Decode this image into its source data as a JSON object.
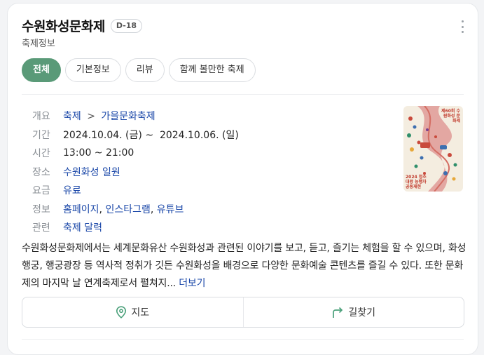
{
  "header": {
    "title": "수원화성문화제",
    "dday_badge": "D-18",
    "subtitle": "축제정보"
  },
  "tabs": [
    {
      "label": "전체",
      "active": true
    },
    {
      "label": "기본정보",
      "active": false
    },
    {
      "label": "리뷰",
      "active": false
    },
    {
      "label": "함께 볼만한 축제",
      "active": false
    }
  ],
  "info": {
    "overview": {
      "label": "개요",
      "category": "축제",
      "separator": ">",
      "subcategory": "가을문화축제"
    },
    "period": {
      "label": "기간",
      "value": "2024.10.04. (금) ~  2024.10.06. (일)"
    },
    "time": {
      "label": "시간",
      "value": "13:00 ~ 21:00"
    },
    "place": {
      "label": "장소",
      "value": "수원화성 일원"
    },
    "fee": {
      "label": "요금",
      "value": "유료"
    },
    "links": {
      "label": "정보",
      "items": [
        "홈페이지",
        "인스타그램",
        "유튜브"
      ],
      "separator": ", "
    },
    "related": {
      "label": "관련",
      "value": "축제 달력"
    }
  },
  "poster": {
    "text_top": "제60회 수원화성 문화제",
    "text_bottom": "2024 정조대왕 능행차 공동재현"
  },
  "description": {
    "text": "수원화성문화제에서는 세계문화유산 수원화성과 관련된 이야기를 보고, 듣고, 즐기는 체험을 할 수 있으며, 화성행궁, 행궁광장 등 역사적 정취가 깃든 수원화성을 배경으로 다양한 문화예술 콘텐츠를 즐길 수 있다. 또한 문화제의 마지막 날 연계축제로서 펼쳐지...",
    "more_label": "더보기"
  },
  "actions": {
    "map_label": "지도",
    "directions_label": "길찾기"
  },
  "colors": {
    "accent": "#5a9a78",
    "link": "#1a47a8"
  }
}
